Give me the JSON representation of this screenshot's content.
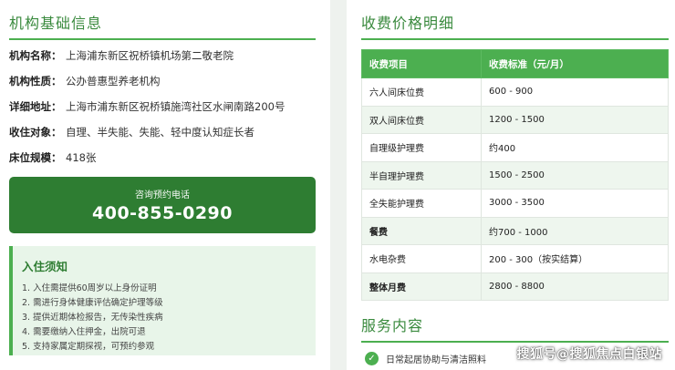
{
  "basic": {
    "title": "机构基础信息",
    "rows": [
      {
        "key": "机构名称：",
        "value": "上海浦东新区祝桥镇机场第二敬老院"
      },
      {
        "key": "机构性质：",
        "value": "公办普惠型养老机构"
      },
      {
        "key": "详细地址：",
        "value": "上海市浦东新区祝桥镇施湾社区水闸南路200号"
      },
      {
        "key": "收住对象：",
        "value": "自理、半失能、失能、轻中度认知症长者"
      },
      {
        "key": "床位规模：",
        "value": "418张"
      }
    ]
  },
  "call": {
    "label": "咨询预约电话",
    "number": "400-855-0290"
  },
  "notice": {
    "title": "入住须知",
    "items": [
      "1. 入住需提供60周岁以上身份证明",
      "2. 需进行身体健康评估确定护理等级",
      "3. 提供近期体检报告，无传染性疾病",
      "4. 需要缴纳入住押金，出院可退",
      "5. 支持家属定期探视，可预约参观"
    ]
  },
  "fees": {
    "title": "收费价格明细",
    "headers": [
      "收费项目",
      "收费标准（元/月）"
    ],
    "rows": [
      {
        "item": "六人间床位费",
        "price": "600 - 900"
      },
      {
        "item": "双人间床位费",
        "price": "1200 - 1500"
      },
      {
        "item": "自理级护理费",
        "price": "约400"
      },
      {
        "item": "半自理护理费",
        "price": "1500 - 2500"
      },
      {
        "item": "全失能护理费",
        "price": "3000 - 3500"
      },
      {
        "item": "餐费",
        "price": "约700 - 1000"
      },
      {
        "item": "水电杂费",
        "price": "200 - 300（按实结算）"
      },
      {
        "item": "整体月费",
        "price": "2800 - 8800"
      }
    ]
  },
  "services": {
    "title": "服务内容",
    "items": [
      "日常起居协助与清洁照料"
    ]
  },
  "watermark": "搜狐号@搜狐焦点白银站",
  "colors": {
    "accent": "#4caf50",
    "dark_green": "#2e7d32",
    "light_green": "#e8f5e9"
  }
}
